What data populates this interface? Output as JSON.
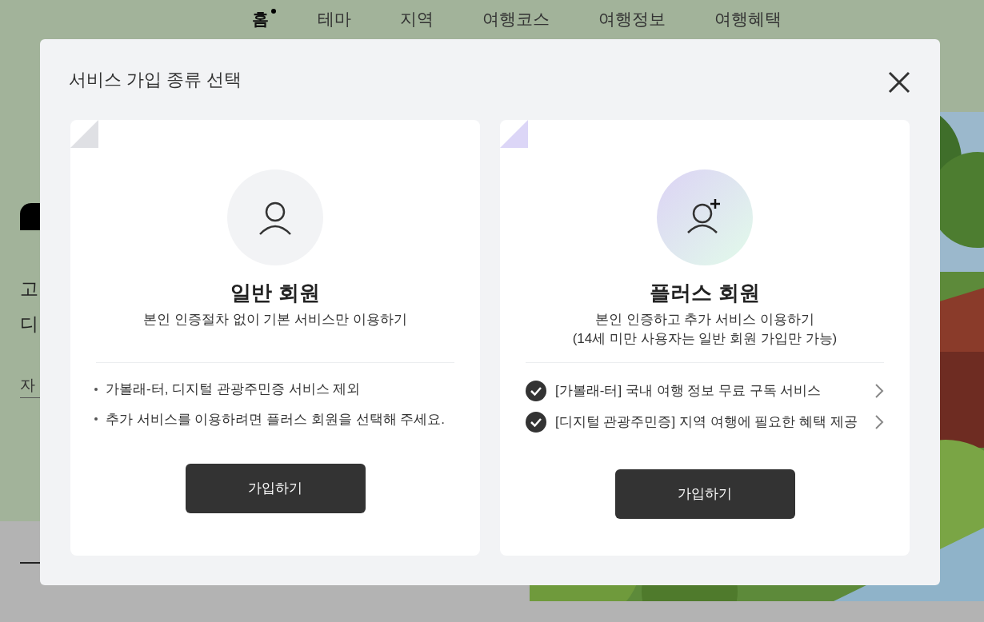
{
  "nav": [
    {
      "label": "홈",
      "selected": true
    },
    {
      "label": "테마",
      "selected": false
    },
    {
      "label": "지역",
      "selected": false
    },
    {
      "label": "여행코스",
      "selected": false
    },
    {
      "label": "여행정보",
      "selected": false
    },
    {
      "label": "여행혜택",
      "selected": false
    }
  ],
  "hero": {
    "headline_lines": [
      "고",
      "디"
    ],
    "link": "자"
  },
  "modal": {
    "title": "서비스 가입 종류 선택",
    "cards": [
      {
        "kind": "basic",
        "title": "일반 회원",
        "description": [
          "본인 인증절차 없이 기본 서비스만 이용하기"
        ],
        "items": [
          {
            "kind": "bullet",
            "text": "가볼래-터, 디지털 관광주민증 서비스 제외"
          },
          {
            "kind": "bullet",
            "text": "추가 서비스를 이용하려면 플러스 회원을 선택해 주세요."
          }
        ],
        "button": "가입하기"
      },
      {
        "kind": "plus",
        "title": "플러스 회원",
        "description": [
          "본인 인증하고 추가 서비스 이용하기",
          "(14세 미만 사용자는 일반 회원 가입만 가능)"
        ],
        "items": [
          {
            "kind": "check",
            "text": "[가볼래-터] 국내 여행 정보 무료 구독 서비스"
          },
          {
            "kind": "check",
            "text": "[디지털 관광주민증] 지역 여행에 필요한 혜택 제공"
          }
        ],
        "button": "가입하기"
      }
    ]
  }
}
